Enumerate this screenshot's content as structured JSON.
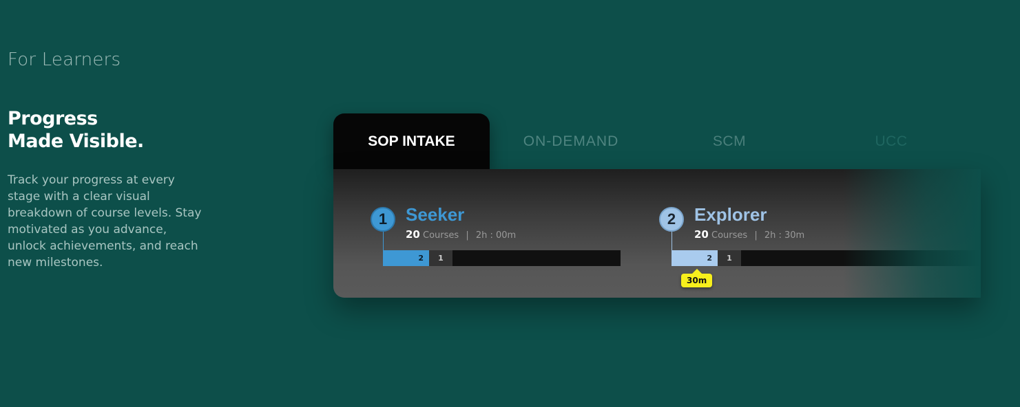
{
  "intro": {
    "eyebrow": "For Learners",
    "headline_line1": "Progress",
    "headline_line2": "Made Visible.",
    "description": "Track your progress at every stage with a clear visual breakdown of course levels. Stay motivated as you advance, unlock achievements, and reach new milestones."
  },
  "tabs": [
    {
      "label": "SOP INTAKE",
      "active": true
    },
    {
      "label": "ON-DEMAND",
      "active": false
    },
    {
      "label": "SCM",
      "active": false
    },
    {
      "label": "UCC",
      "active": false
    }
  ],
  "levels": [
    {
      "number": "1",
      "name": "Seeker",
      "courses_count": "20",
      "courses_label": "Courses",
      "separator": "|",
      "duration": "2h : 00m",
      "bar": {
        "primary": "2",
        "secondary": "1"
      },
      "color": "#3e98d4"
    },
    {
      "number": "2",
      "name": "Explorer",
      "courses_count": "20",
      "courses_label": "Courses",
      "separator": "|",
      "duration": "2h : 30m",
      "bar": {
        "primary": "2",
        "secondary": "1"
      },
      "color": "#9fc3e6"
    }
  ],
  "tooltip": {
    "label": "30m",
    "color": "#f7ef1c"
  },
  "colors": {
    "background": "#0d4f4a",
    "accent": "#3e98d4"
  }
}
